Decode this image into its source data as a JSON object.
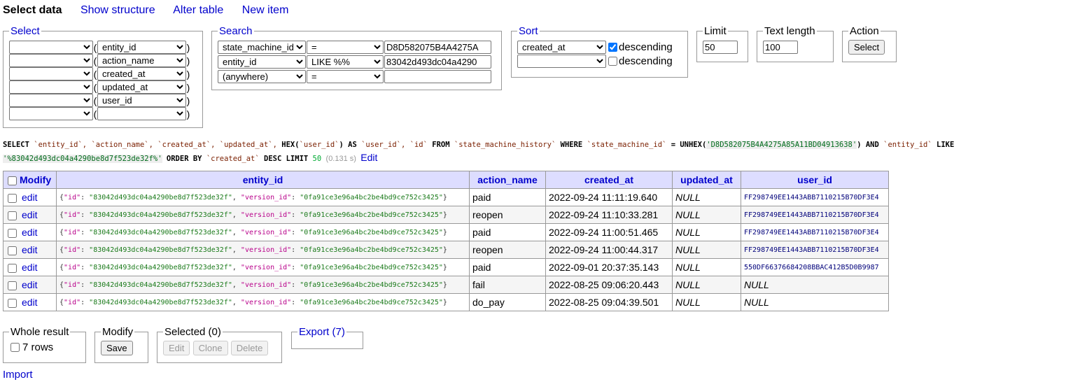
{
  "menu": {
    "select_data": "Select data",
    "show_structure": "Show structure",
    "alter_table": "Alter table",
    "new_item": "New item"
  },
  "select": {
    "legend": "Select",
    "columns": [
      "entity_id",
      "action_name",
      "created_at",
      "updated_at",
      "user_id",
      ""
    ]
  },
  "search": {
    "legend": "Search",
    "rows": [
      {
        "column": "state_machine_id",
        "op": "=",
        "value": "D8D582075B4A4275A"
      },
      {
        "column": "entity_id",
        "op": "LIKE %%",
        "value": "83042d493dc04a4290"
      },
      {
        "column": "(anywhere)",
        "op": "=",
        "value": ""
      }
    ]
  },
  "sort": {
    "legend": "Sort",
    "rows": [
      {
        "column": "created_at",
        "descending": true,
        "label": "descending"
      },
      {
        "column": "",
        "descending": false,
        "label": "descending"
      }
    ]
  },
  "limit": {
    "legend": "Limit",
    "value": "50"
  },
  "text_length": {
    "legend": "Text length",
    "value": "100"
  },
  "action": {
    "legend": "Action",
    "button": "Select"
  },
  "query": {
    "p1": "SELECT",
    "p2": "`entity_id`, `action_name`, `created_at`, `updated_at`,",
    "p3": "HEX(",
    "p4": "`user_id`",
    "p5": ") AS",
    "p6": "`user_id`, `id`",
    "p7": "FROM",
    "p8": "`state_machine_history`",
    "p9": "WHERE",
    "p10": "`state_machine_id`",
    "p11": "= UNHEX(",
    "p12": "'D8D582075B4A4275A85A11BD04913638'",
    "p13": ") AND",
    "p14": "`entity_id`",
    "p15": "LIKE",
    "p16": "'%83042d493dc04a4290be8d7f523de32f%'",
    "p17": "ORDER BY",
    "p18": "`created_at`",
    "p19": "DESC LIMIT",
    "p20": "50",
    "time": "(0.131 s)",
    "edit": "Edit"
  },
  "table": {
    "headers": {
      "modify": "Modify",
      "entity_id": "entity_id",
      "action_name": "action_name",
      "created_at": "created_at",
      "updated_at": "updated_at",
      "user_id": "user_id"
    },
    "edit_label": "edit",
    "json_id_key": "\"id\"",
    "json_version_key": "\"version_id\"",
    "json_id_val": "\"83042d493dc04a4290be8d7f523de32f\"",
    "json_version_val": "\"0fa91ce3e96a4bc2be4bd9ce752c3425\"",
    "rows": [
      {
        "action": "paid",
        "created": "2022-09-24 11:11:19.640",
        "updated": "NULL",
        "user": "FF298749EE1443ABB7110215B70DF3E4"
      },
      {
        "action": "reopen",
        "created": "2022-09-24 11:10:33.281",
        "updated": "NULL",
        "user": "FF298749EE1443ABB7110215B70DF3E4"
      },
      {
        "action": "paid",
        "created": "2022-09-24 11:00:51.465",
        "updated": "NULL",
        "user": "FF298749EE1443ABB7110215B70DF3E4"
      },
      {
        "action": "reopen",
        "created": "2022-09-24 11:00:44.317",
        "updated": "NULL",
        "user": "FF298749EE1443ABB7110215B70DF3E4"
      },
      {
        "action": "paid",
        "created": "2022-09-01 20:37:35.143",
        "updated": "NULL",
        "user": "550DF66376684208BBAC412B5D0B9987"
      },
      {
        "action": "fail",
        "created": "2022-08-25 09:06:20.443",
        "updated": "NULL",
        "user": "NULL"
      },
      {
        "action": "do_pay",
        "created": "2022-08-25 09:04:39.501",
        "updated": "NULL",
        "user": "NULL"
      }
    ]
  },
  "footer": {
    "whole_legend": "Whole result",
    "rows_label": "7 rows",
    "modify_legend": "Modify",
    "save": "Save",
    "selected_legend": "Selected (0)",
    "edit": "Edit",
    "clone": "Clone",
    "delete": "Delete",
    "export_legend": "Export (7)",
    "import": "Import"
  }
}
